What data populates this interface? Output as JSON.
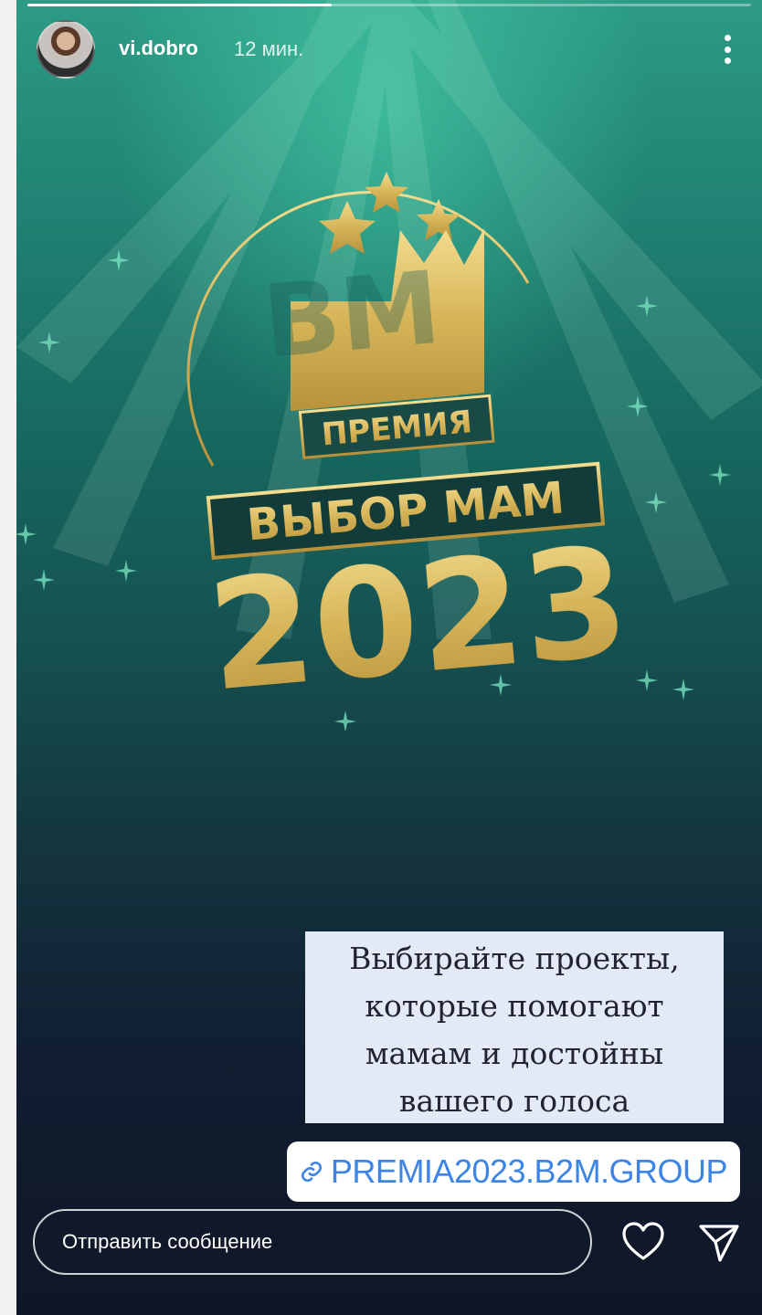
{
  "header": {
    "username": "vi.dobro",
    "time_ago": "12 мин.",
    "progress_fraction": 0.42,
    "more_icon": "more-vertical-icon"
  },
  "artwork": {
    "logo_letters": "ВМ",
    "award_label": "ПРЕМИЯ",
    "award_name": "ВЫБОР МАМ",
    "year": "2023",
    "colors": {
      "gold": "#d8b65a",
      "teal": "#2c9b85",
      "navy": "#0f1628"
    }
  },
  "caption": {
    "lines": [
      "Выбирайте проекты,",
      "которые помогают",
      "мамам и достойны",
      "вашего голоса"
    ]
  },
  "link_sticker": {
    "icon": "link-icon",
    "text": "PREMIA2023.B2M.GROUP",
    "color": "#3c84e6"
  },
  "reply": {
    "placeholder": "Отправить сообщение",
    "like_icon": "heart-icon",
    "send_icon": "send-icon"
  }
}
